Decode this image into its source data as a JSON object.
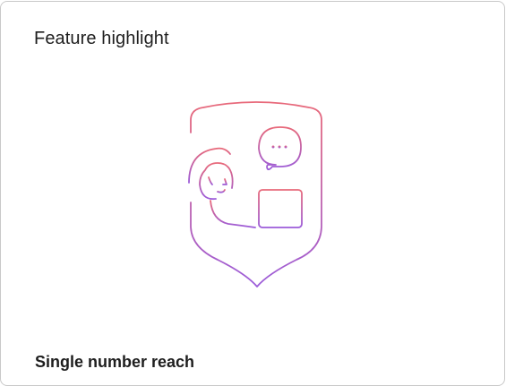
{
  "card": {
    "title": "Feature highlight",
    "feature_name": "Single number reach"
  },
  "illustration": {
    "icon": "shield-person-chat-laptop-icon",
    "gradient_top_color": "#E8697A",
    "gradient_bottom_color": "#9B5CDA"
  }
}
